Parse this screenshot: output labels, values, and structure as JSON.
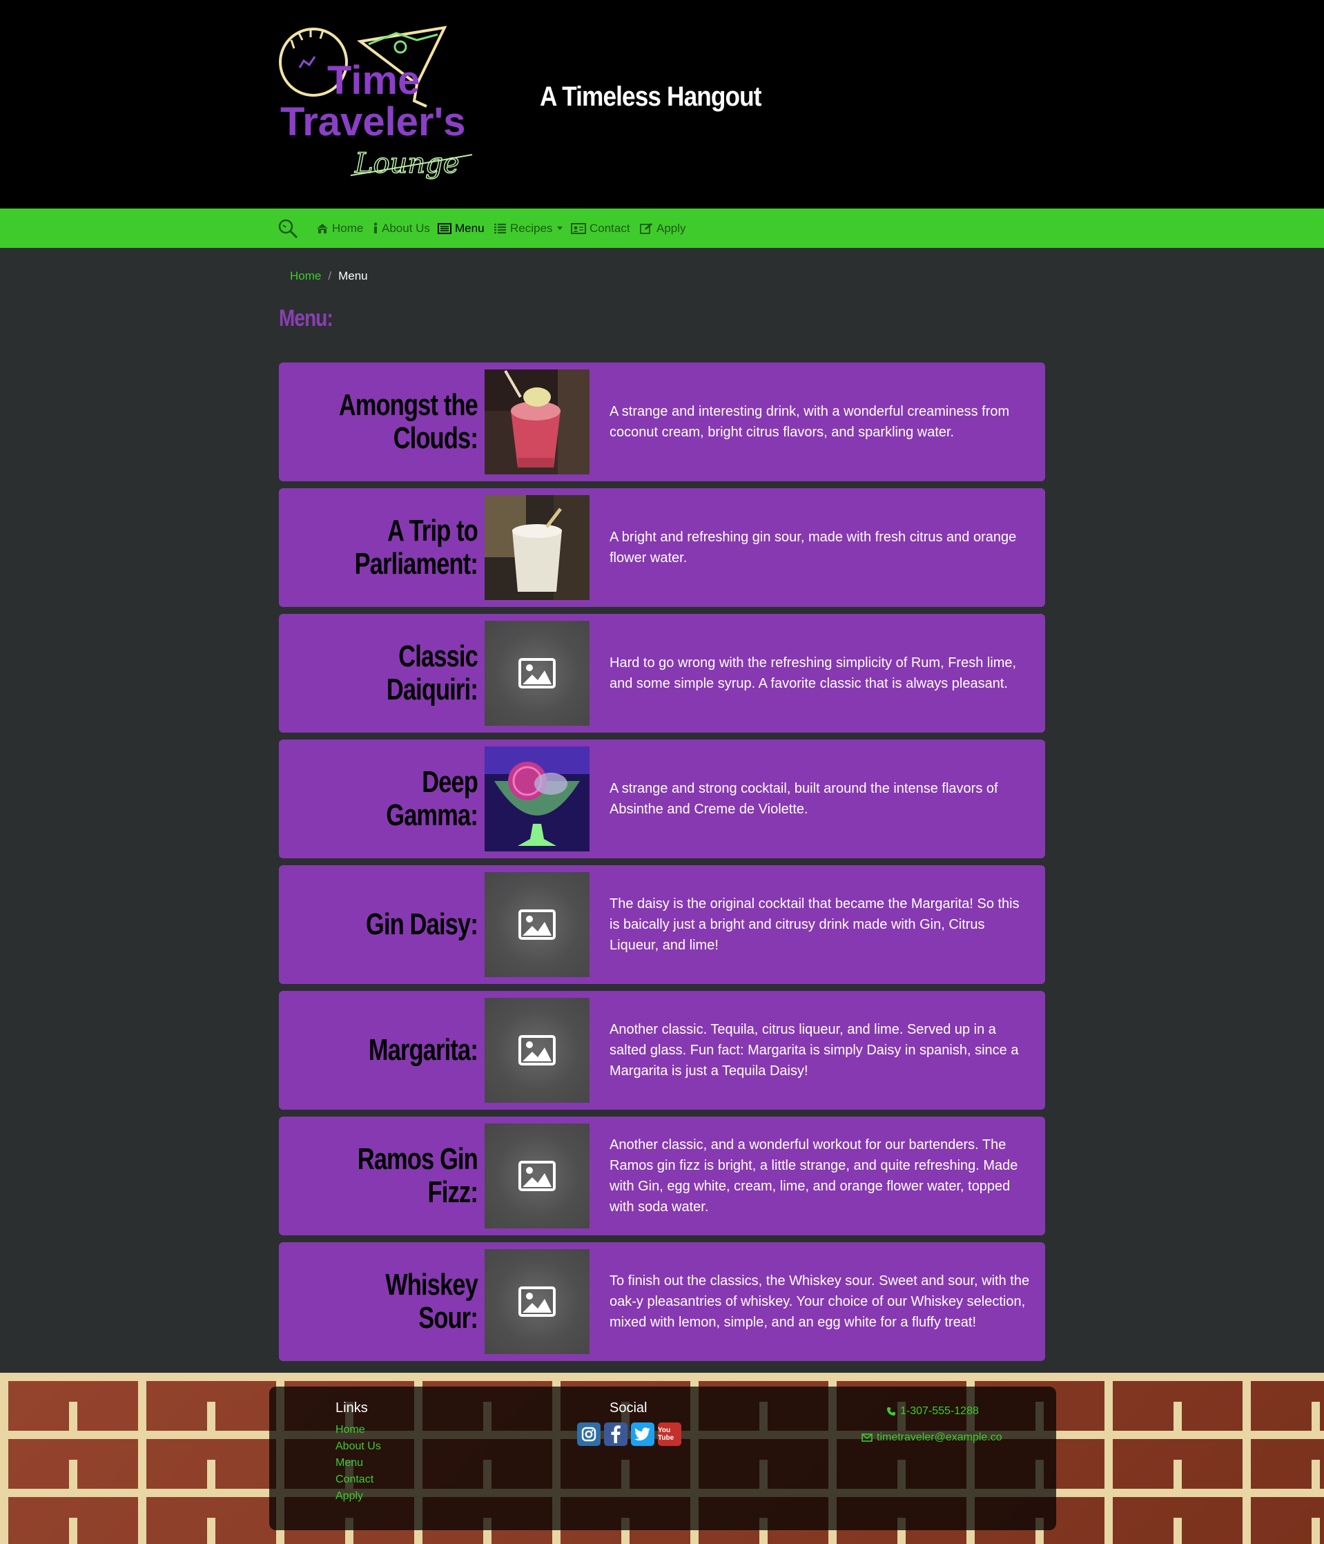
{
  "header": {
    "logo": {
      "line1": "Time",
      "line2": "Traveler's",
      "line3": "Lounge"
    },
    "tagline": "A Timeless Hangout"
  },
  "nav": {
    "items": [
      {
        "label": "Home",
        "icon": "home-icon"
      },
      {
        "label": "About Us",
        "icon": "info-icon"
      },
      {
        "label": "Menu",
        "icon": "menu-card-icon",
        "active": true
      },
      {
        "label": "Recipes",
        "icon": "list-icon",
        "dropdown": true
      },
      {
        "label": "Contact",
        "icon": "contact-card-icon"
      },
      {
        "label": "Apply",
        "icon": "edit-icon"
      }
    ]
  },
  "breadcrumb": {
    "home": "Home",
    "separator": "/",
    "current": "Menu"
  },
  "page_title": "Menu:",
  "menu": [
    {
      "name": "Amongst the Clouds:",
      "image": "photo",
      "description": "A strange and interesting drink, with a wonderful creaminess from coconut cream, bright citrus flavors, and sparkling water."
    },
    {
      "name": "A Trip to Parliament:",
      "image": "photo",
      "description": "A bright and refreshing gin sour, made with fresh citrus and orange flower water."
    },
    {
      "name": "Classic Daiquiri:",
      "image": "placeholder",
      "description": "Hard to go wrong with the refreshing simplicity of Rum, Fresh lime, and some simple syrup. A favorite classic that is always pleasant."
    },
    {
      "name": "Deep Gamma:",
      "image": "photo",
      "description": "A strange and strong cocktail, built around the intense flavors of Absinthe and Creme de Violette."
    },
    {
      "name": "Gin Daisy:",
      "image": "placeholder",
      "description": "The daisy is the original cocktail that became the Margarita! So this is baically just a bright and citrusy drink made with Gin, Citrus Liqueur, and lime!"
    },
    {
      "name": "Margarita:",
      "image": "placeholder",
      "description": "Another classic. Tequila, citrus liqueur, and lime. Served up in a salted glass. Fun fact: Margarita is simply Daisy in spanish, since a Margarita is just a Tequila Daisy!"
    },
    {
      "name": "Ramos Gin Fizz:",
      "image": "placeholder",
      "description": "Another classic, and a wonderful workout for our bartenders. The Ramos gin fizz is bright, a little strange, and quite refreshing. Made with Gin, egg white, cream, lime, and orange flower water, topped with soda water."
    },
    {
      "name": "Whiskey Sour:",
      "image": "placeholder",
      "description": "To finish out the classics, the Whiskey sour. Sweet and sour, with the oak-y pleasantries of whiskey. Your choice of our Whiskey selection, mixed with lemon, simple, and an egg white for a fluffy treat!"
    }
  ],
  "footer": {
    "links_heading": "Links",
    "links": [
      "Home",
      "About Us",
      "Menu",
      "Contact",
      "Apply"
    ],
    "social_heading": "Social",
    "social": [
      {
        "name": "instagram-icon",
        "color": "#2f6fa8"
      },
      {
        "name": "facebook-icon",
        "color": "#3b5998"
      },
      {
        "name": "twitter-icon",
        "color": "#1da1f2"
      },
      {
        "name": "youtube-icon",
        "color": "#c4302b",
        "text": "You Tube"
      }
    ],
    "phone": "1-307-555-1288",
    "email": "timetraveler@example.co"
  },
  "colors": {
    "accent_green": "#3fcb2c",
    "card_purple": "#8739b1",
    "title_purple": "#8a3fb3",
    "background": "#2b2f30"
  }
}
